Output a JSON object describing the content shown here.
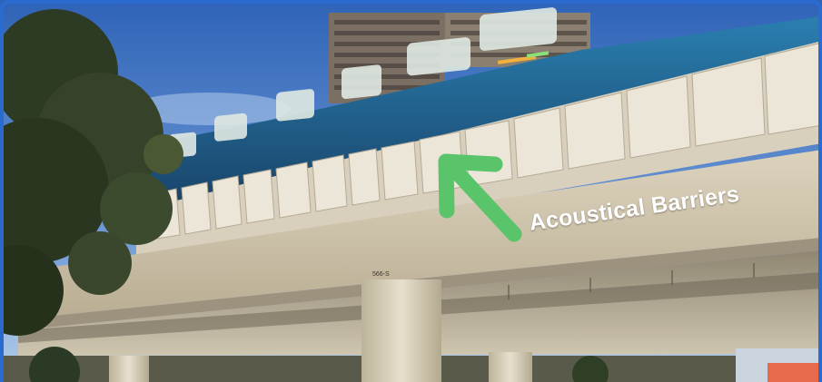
{
  "annotation": {
    "label": "Acoustical Barriers",
    "arrow_color": "#59c46a",
    "label_color": "#ffffff"
  },
  "pier_marking": "566-S",
  "colors": {
    "sky_top": "#2f63b7",
    "sky_bottom": "#9fc0e6",
    "train_body": "#1d5a86",
    "barrier_panel": "#e8e1d3",
    "concrete": "#c9bfa9",
    "frame_border": "#2b6bd0"
  }
}
